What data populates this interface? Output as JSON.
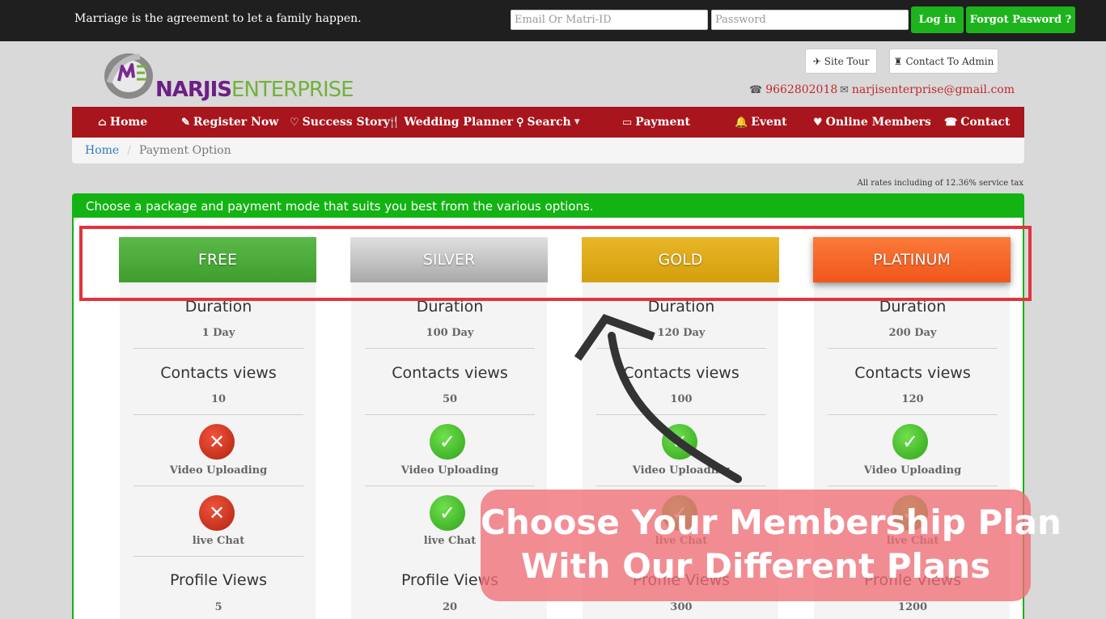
{
  "topbar": {
    "tagline": "Marriage is the agreement to let a family happen.",
    "email_placeholder": "Email Or Matri-ID",
    "password_placeholder": "Password",
    "login_label": "Log in",
    "forgot_label": "Forgot Pasword ?"
  },
  "header": {
    "brand_part1": "NARJIS",
    "brand_part2": "ENTERPRISE",
    "site_tour_label": "Site Tour",
    "contact_admin_label": "Contact To Admin",
    "phone": "9662802018",
    "email": "narjisenterprise@gmail.com"
  },
  "nav": {
    "items": [
      {
        "label": "Home",
        "icon": "home-icon"
      },
      {
        "label": "Register Now",
        "icon": "pencil-icon"
      },
      {
        "label": "Success Story",
        "icon": "heart-icon"
      },
      {
        "label": "Wedding Planner",
        "icon": "cutlery-icon"
      },
      {
        "label": "Search",
        "icon": "search-icon"
      },
      {
        "label": "Payment",
        "icon": "credit-card-icon"
      },
      {
        "label": "Event",
        "icon": "bell-icon"
      },
      {
        "label": "Online Members",
        "icon": "heart-icon"
      },
      {
        "label": "Contact",
        "icon": "phone-icon"
      }
    ]
  },
  "breadcrumb": {
    "home": "Home",
    "separator": "/",
    "current": "Payment Option"
  },
  "tax_note": "All rates including of 12.36% service tax",
  "panel": {
    "heading": "Choose a package and payment mode that suits you best from the various options."
  },
  "labels": {
    "duration": "Duration",
    "contacts_views": "Contacts views",
    "video_uploading": "Video Uploading",
    "live_chat": "live Chat",
    "profile_views": "Profile Views"
  },
  "plans": [
    {
      "name": "FREE",
      "duration": "1 Day",
      "contacts": "10",
      "video": false,
      "chat": false,
      "profile_views": "5"
    },
    {
      "name": "SILVER",
      "duration": "100 Day",
      "contacts": "50",
      "video": true,
      "chat": true,
      "profile_views": "20"
    },
    {
      "name": "GOLD",
      "duration": "120 Day",
      "contacts": "100",
      "video": true,
      "chat": true,
      "profile_views": "300"
    },
    {
      "name": "PLATINUM",
      "duration": "200 Day",
      "contacts": "120",
      "video": true,
      "chat": true,
      "profile_views": "1200"
    }
  ],
  "callout": {
    "line1": "Choose Your Membership Plan",
    "line2": "With Our Different Plans"
  },
  "colors": {
    "topbar": "#1f1f1f",
    "nav": "#a8151c",
    "accent_green": "#13b313",
    "highlight_red": "#e1343f"
  }
}
